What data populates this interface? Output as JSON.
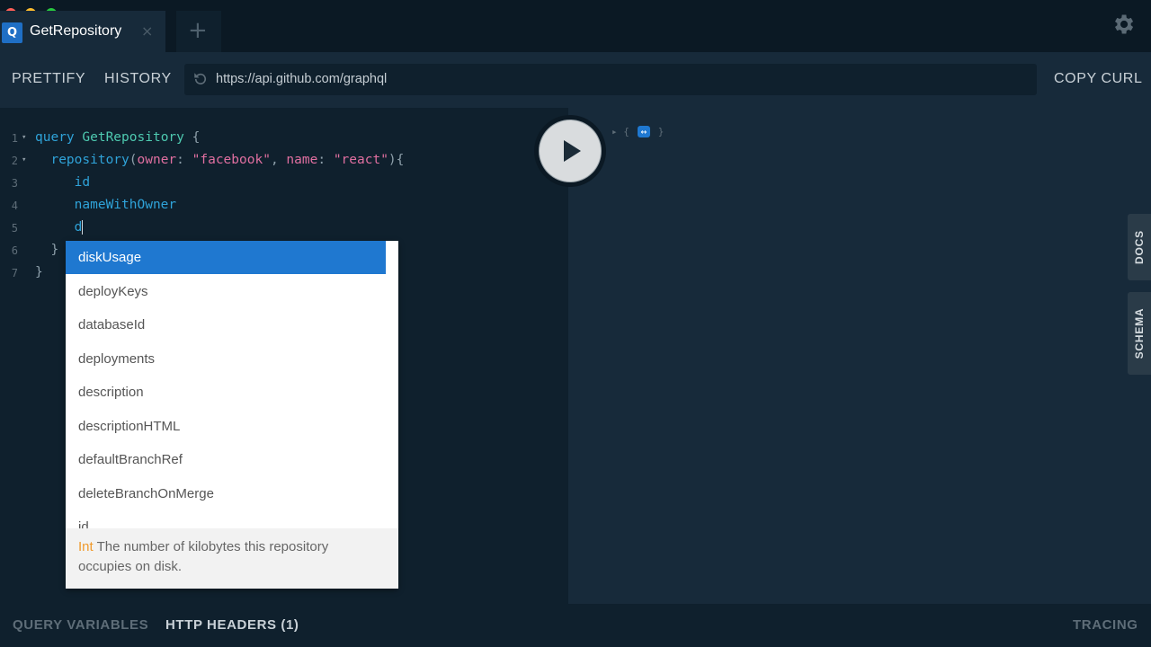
{
  "window": {
    "tab": {
      "icon_letter": "Q",
      "title": "GetRepository",
      "close_symbol": "×"
    },
    "add_tab_symbol": "+"
  },
  "toolbar": {
    "prettify_label": "PRETTIFY",
    "history_label": "HISTORY",
    "url": "https://api.github.com/graphql",
    "copy_curl_label": "COPY CURL"
  },
  "editor": {
    "lines": [
      {
        "number": "1",
        "folded_marker": "▾",
        "tokens": [
          "query",
          "GetRepository",
          "{"
        ]
      },
      {
        "number": "2",
        "folded_marker": "▾",
        "tokens": [
          "repository",
          "(",
          "owner",
          ":",
          "\"facebook\"",
          ",",
          "name",
          ":",
          "\"react\"",
          "){"
        ]
      },
      {
        "number": "3",
        "tokens": [
          "id"
        ]
      },
      {
        "number": "4",
        "tokens": [
          "nameWithOwner"
        ]
      },
      {
        "number": "5",
        "tokens": [
          "d"
        ]
      },
      {
        "number": "6",
        "tokens": [
          "}"
        ]
      },
      {
        "number": "7",
        "tokens": [
          "}"
        ]
      }
    ]
  },
  "autocomplete": {
    "items": [
      "diskUsage",
      "deployKeys",
      "databaseId",
      "deployments",
      "description",
      "descriptionHTML",
      "defaultBranchRef",
      "deleteBranchOnMerge",
      "id"
    ],
    "selected": "diskUsage",
    "description_type": "Int",
    "description_text": "The number of kilobytes this repository occupies on disk."
  },
  "result": {
    "stub_open": "▸ {",
    "stub_pill": "↔",
    "stub_close": "}"
  },
  "side_tabs": {
    "docs": "DOCS",
    "schema": "SCHEMA"
  },
  "bottom": {
    "query_variables": "QUERY VARIABLES",
    "http_headers": "HTTP HEADERS (1)",
    "tracing": "TRACING"
  },
  "colors": {
    "background": "#0f202d",
    "panel": "#172a3a",
    "accent_blue": "#1f78d0",
    "keyword": "#2fa3d9",
    "string": "#e06fa0",
    "type": "#f09a2c"
  },
  "icons": [
    "settings-gear-icon",
    "reload-icon",
    "play-icon",
    "close-icon",
    "plus-icon"
  ]
}
